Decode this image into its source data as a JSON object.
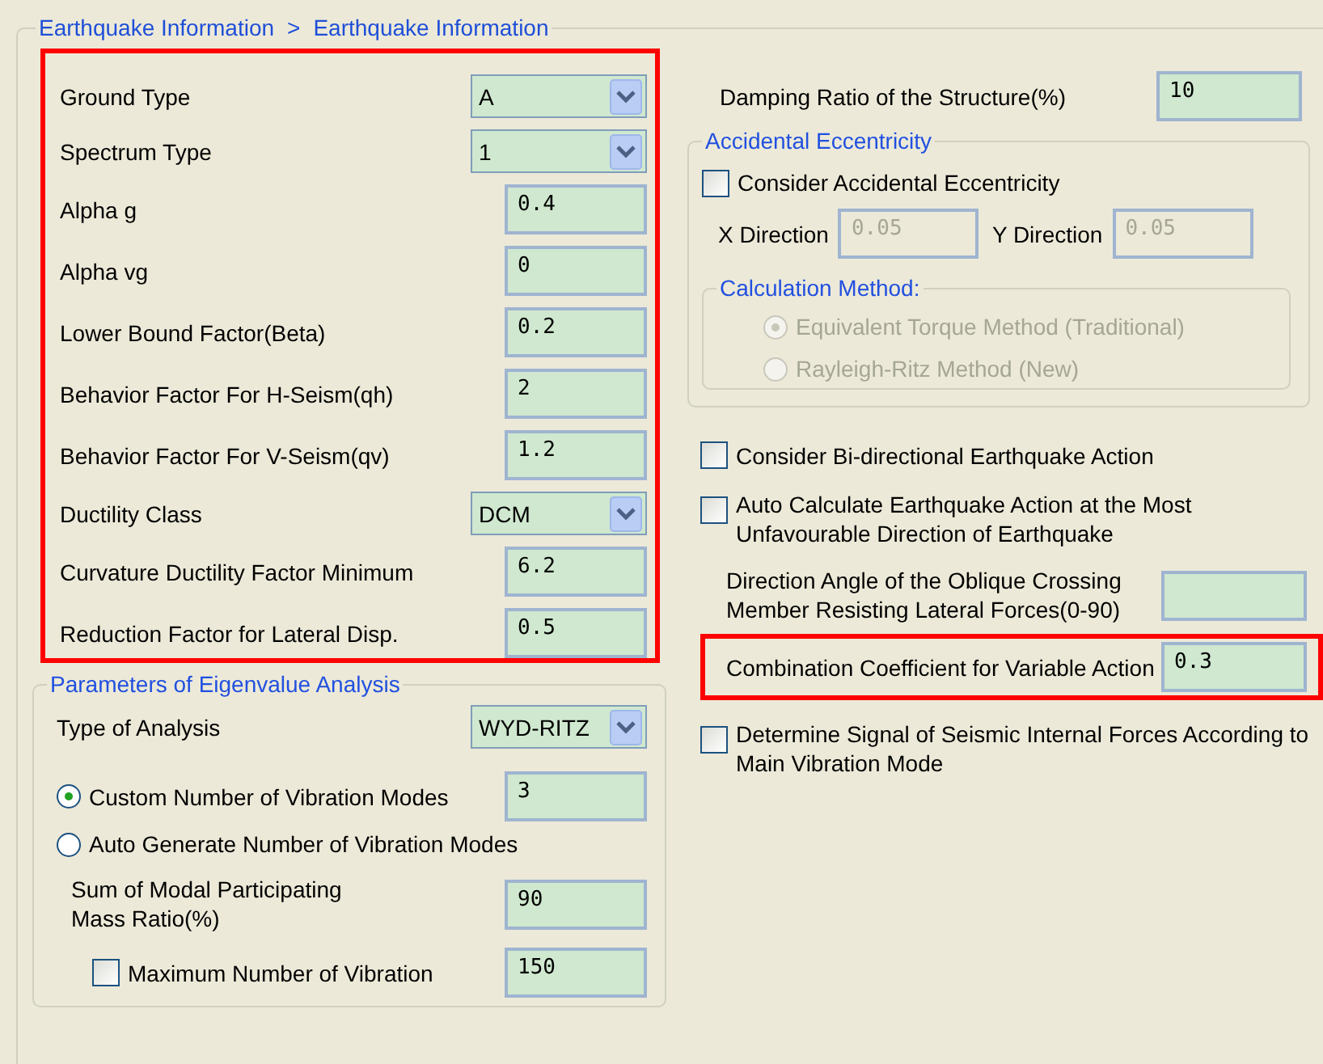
{
  "breadcrumb": {
    "items": [
      "Earthquake Information",
      "Earthquake Information"
    ],
    "separator": ">"
  },
  "seismic_params": {
    "highlighted": true,
    "fields": [
      {
        "label": "Ground Type",
        "kind": "dropdown",
        "value": "A"
      },
      {
        "label": "Spectrum Type",
        "kind": "dropdown",
        "value": "1"
      },
      {
        "label": "Alpha g",
        "kind": "input",
        "value": "0.4"
      },
      {
        "label": "Alpha vg",
        "kind": "input",
        "value": "0"
      },
      {
        "label": "Lower Bound Factor(Beta)",
        "kind": "input",
        "value": "0.2"
      },
      {
        "label": "Behavior Factor For H-Seism(qh)",
        "kind": "input",
        "value": "2"
      },
      {
        "label": "Behavior Factor For V-Seism(qv)",
        "kind": "input",
        "value": "1.2"
      },
      {
        "label": "Ductility Class",
        "kind": "dropdown",
        "value": "DCM"
      },
      {
        "label": "Curvature Ductility Factor Minimum",
        "kind": "input",
        "value": "6.2"
      },
      {
        "label": "Reduction Factor for Lateral Disp.",
        "kind": "input",
        "value": "0.5"
      }
    ]
  },
  "eigenvalue": {
    "title": "Parameters of Eigenvalue Analysis",
    "type_of_analysis": {
      "label": "Type of Analysis",
      "value": "WYD-RITZ"
    },
    "modes": [
      {
        "label": "Custom Number of Vibration Modes",
        "selected": true,
        "value": "3"
      },
      {
        "label": "Auto Generate Number of Vibration Modes",
        "selected": false
      }
    ],
    "sum_ratio": {
      "label": "Sum of Modal Participating Mass Ratio(%)",
      "value": "90"
    },
    "max_modes": {
      "label": "Maximum Number of Vibration",
      "checked": false,
      "value": "150"
    }
  },
  "damping": {
    "label": "Damping Ratio of the Structure(%)",
    "value": "10"
  },
  "eccentricity": {
    "title": "Accidental Eccentricity",
    "checkbox": {
      "label": "Consider Accidental Eccentricity",
      "checked": false
    },
    "directions": [
      {
        "label": "X Direction",
        "value": "0.05",
        "disabled": true
      },
      {
        "label": "Y Direction",
        "value": "0.05",
        "disabled": true
      }
    ],
    "calc_method": {
      "title": "Calculation Method:",
      "disabled": true,
      "options": [
        {
          "label": "Equivalent Torque Method (Traditional)",
          "selected": true
        },
        {
          "label": "Rayleigh-Ritz Method (New)",
          "selected": false
        }
      ]
    }
  },
  "options": [
    {
      "kind": "checkbox",
      "label": "Consider Bi-directional Earthquake Action",
      "checked": false
    },
    {
      "kind": "checkbox",
      "label": "Auto Calculate Earthquake Action at the Most Unfavourable Direction of Earthquake",
      "checked": false
    },
    {
      "kind": "field",
      "label": "Direction Angle of the Oblique Crossing Member Resisting Lateral Forces(0-90)",
      "highlighted": false
    },
    {
      "kind": "field",
      "label": "Combination Coefficient for Variable Action",
      "value": "0.3",
      "highlighted": true
    },
    {
      "kind": "checkbox",
      "label": "Determine Signal of Seismic Internal Forces According to Main Vibration Mode",
      "checked": false
    }
  ]
}
